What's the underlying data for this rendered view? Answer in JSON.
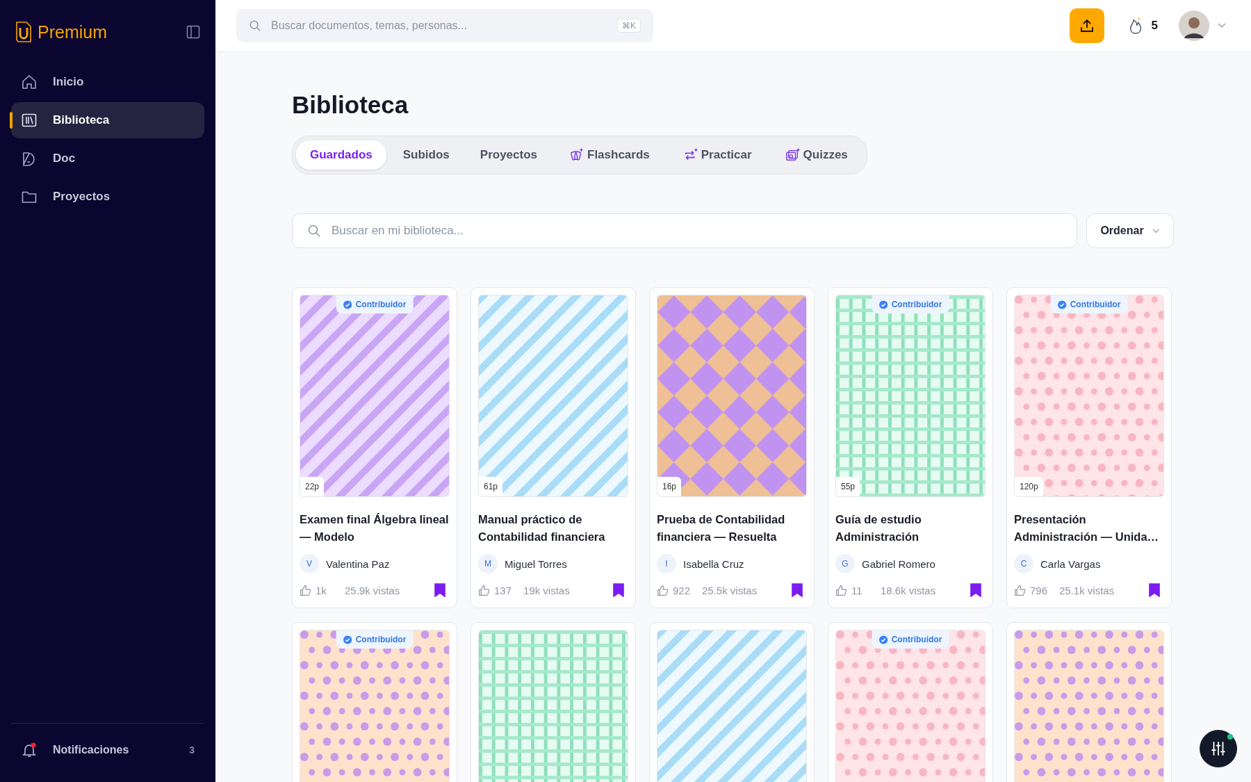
{
  "sidebar": {
    "brand": "Premium",
    "items": [
      {
        "label": "Inicio",
        "selected": false
      },
      {
        "label": "Biblioteca",
        "selected": true
      },
      {
        "label": "Doc",
        "selected": false
      },
      {
        "label": "Proyectos",
        "selected": false
      }
    ],
    "notifications": {
      "label": "Notificaciones",
      "count": "3",
      "unread": true
    }
  },
  "topbar": {
    "search": {
      "placeholder": "Buscar documentos, temas, personas...",
      "shortcut": "⌘K"
    },
    "streak": "5"
  },
  "page": {
    "title": "Biblioteca",
    "tabs": [
      {
        "label": "Guardados",
        "selected": true
      },
      {
        "label": "Subidos",
        "selected": false
      },
      {
        "label": "Proyectos",
        "selected": false
      },
      {
        "label": "Flashcards",
        "selected": false
      },
      {
        "label": "Practicar",
        "selected": false
      },
      {
        "label": "Quizzes",
        "selected": false
      }
    ],
    "search": {
      "placeholder": "Buscar en mi biblioteca..."
    },
    "sort": "Ordenar",
    "cards": [
      {
        "cover": {
          "kind": "picture"
        },
        "badge": "Contribuidor",
        "pages": "22p",
        "title": "Examen final Álgebra lineal — Modelo",
        "initial": "V",
        "author": "Valentina Paz",
        "likes": "1k",
        "views": "25.9k vistas",
        "saved": true
      },
      {
        "cover": {
          "kind": "picture"
        },
        "pages": "61p",
        "title": "Manual práctico de Contabilidad financiera",
        "initial": "M",
        "author": "Miguel Torres",
        "likes": "137",
        "views": "19k vistas",
        "saved": true
      },
      {
        "cover": {
          "kind": "picture"
        },
        "pages": "16p",
        "title": "Prueba de Contabilidad financiera — Resuelta",
        "initial": "I",
        "author": "Isabella Cruz",
        "likes": "922",
        "views": "25.5k vistas",
        "saved": true
      },
      {
        "cover": {
          "kind": "picture"
        },
        "badge": "Contribuidor",
        "pages": "55p",
        "title": "Guía de estudio Administración",
        "initial": "G",
        "author": "Gabriel Romero",
        "likes": "11",
        "views": "18.6k vistas",
        "saved": true
      },
      {
        "cover": {
          "kind": "picture"
        },
        "badge": "Contribuidor",
        "pages": "120p",
        "title": "Presentación Administración — Unida…",
        "initial": "C",
        "author": "Carla Vargas",
        "likes": "796",
        "views": "25.1k vistas",
        "saved": true
      },
      {
        "cover": {
          "kind": "picture"
        },
        "badge": "Contribuidor"
      },
      {
        "cover": {
          "kind": "picture"
        }
      },
      {
        "cover": {
          "kind": "picture"
        }
      },
      {
        "cover": {
          "kind": "picture"
        },
        "badge": "Contribuidor"
      },
      {
        "cover": {
          "kind": "picture"
        }
      }
    ]
  }
}
